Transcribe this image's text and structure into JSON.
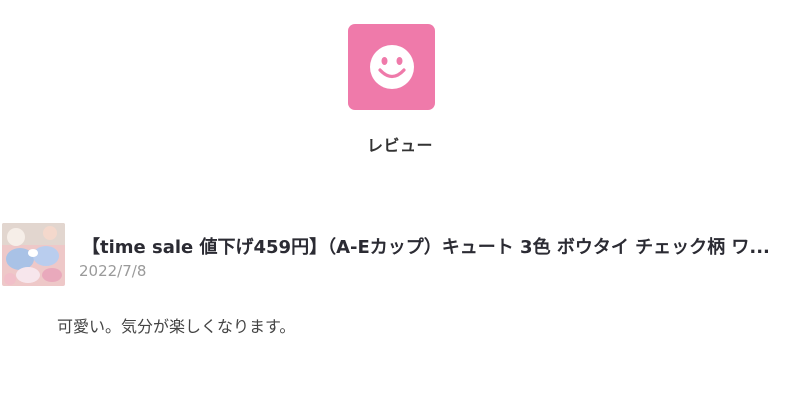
{
  "header": {
    "icon": "smiley-face-icon",
    "icon_color": "#ef7aaa",
    "label": "レビュー"
  },
  "review": {
    "thumbnail": "product-thumbnail-image",
    "product_title": "【time sale 値下げ459円】（A-Eカップ）キュート 3色 ボウタイ チェック柄 ワ...",
    "date": "2022/7/8",
    "body": "可愛い。気分が楽しくなります。"
  }
}
